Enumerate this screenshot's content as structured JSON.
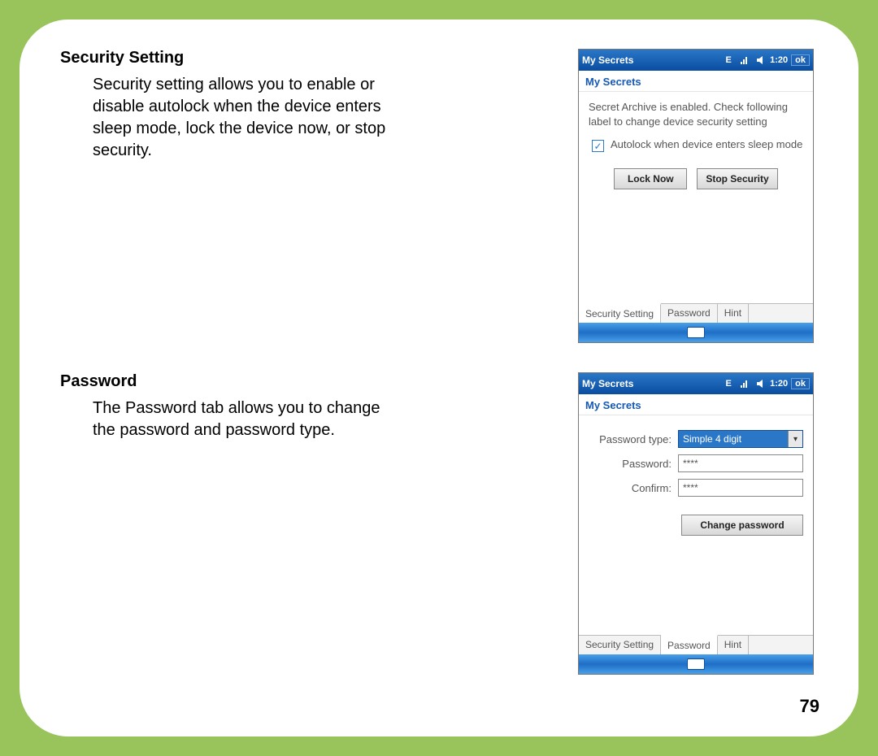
{
  "page_number": "79",
  "section1": {
    "heading": "Security Setting",
    "body": "Security setting allows you to enable or disable autolock when the device enters sleep mode, lock the device now, or stop security."
  },
  "section2": {
    "heading": "Password",
    "body": "The Password tab allows you to change the password and password type."
  },
  "device_common": {
    "title": "My Secrets",
    "subheader": "My Secrets",
    "time": "1:20",
    "ok": "ok",
    "tabs": {
      "t1": "Security Setting",
      "t2": "Password",
      "t3": "Hint"
    }
  },
  "device1": {
    "info": "Secret Archive is enabled. Check following label to change device security setting",
    "checkbox_label": "Autolock when device enters sleep mode",
    "lock_now": "Lock Now",
    "stop_security": "Stop Security"
  },
  "device2": {
    "pwtype_label": "Password type:",
    "pwtype_value": "Simple 4 digit",
    "password_label": "Password:",
    "password_value": "****",
    "confirm_label": "Confirm:",
    "confirm_value": "****",
    "change_btn": "Change password"
  }
}
